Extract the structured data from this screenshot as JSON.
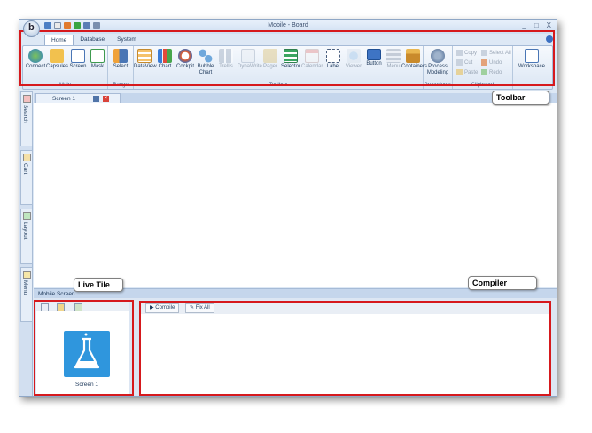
{
  "window": {
    "title": "Mobile - Board",
    "controls": [
      "_",
      "□",
      "X"
    ]
  },
  "app_button_letter": "b",
  "ribbon_tabs": [
    "Home",
    "Database",
    "System"
  ],
  "ribbon": {
    "main": {
      "label": "Main",
      "buttons": [
        "Connect",
        "Capsules",
        "Screen",
        "Mask"
      ]
    },
    "range": {
      "label": "Range",
      "buttons": [
        "Select"
      ]
    },
    "toolbox": {
      "label": "Toolbox",
      "buttons": [
        "DataView",
        "Chart",
        "Cockpit",
        "Bubble Chart",
        "Trellis",
        "DynaWrite",
        "Pager",
        "Selector",
        "Calendar",
        "Label",
        "Viewer",
        "Button",
        "Menu",
        "Containers"
      ]
    },
    "procedures": {
      "label": "Procedures",
      "buttons": [
        "Process Modeling"
      ]
    },
    "clipboard": {
      "label": "Clipboard",
      "buttons": [
        "Copy",
        "Select All",
        "Cut",
        "Undo",
        "Paste",
        "Redo"
      ]
    },
    "workspace": {
      "label": "",
      "buttons": [
        "Workspace"
      ]
    }
  },
  "side_tabs": [
    "Search",
    "Cart",
    "Layout",
    "Menu"
  ],
  "document_tab": {
    "label": "Screen 1"
  },
  "bottom_panel": {
    "header": "Mobile Screen",
    "tile_label": "Screen 1",
    "compiler_buttons": [
      "Compile",
      "Fix All"
    ]
  },
  "callouts": {
    "toolbar": "Toolbar",
    "live_tile": "Live Tile",
    "compiler": "Compiler"
  },
  "colors": {
    "highlight": "#d6191d",
    "tile": "#2f96dd",
    "ribbon_bg": "#dbe6f4"
  }
}
